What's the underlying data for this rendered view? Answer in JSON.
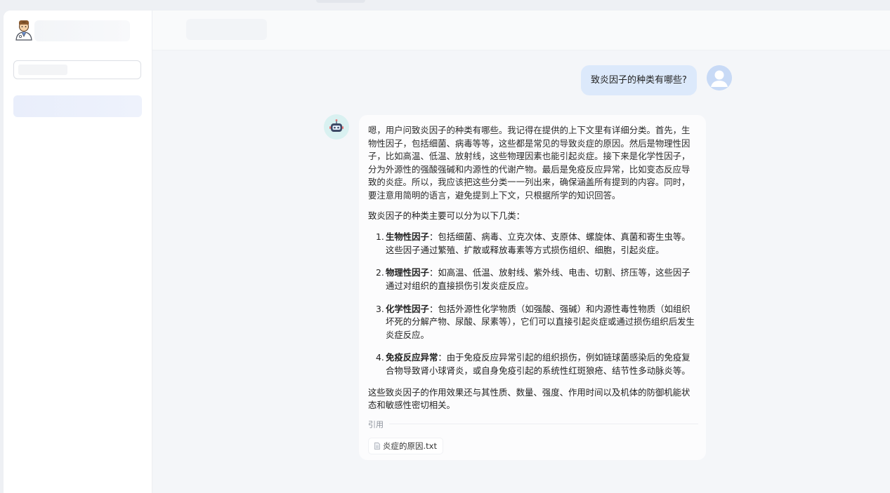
{
  "user_message": "致炎因子的种类有哪些?",
  "assistant": {
    "thinking": "嗯，用户问致炎因子的种类有哪些。我记得在提供的上下文里有详细分类。首先，生物性因子，包括细菌、病毒等等，这些都是常见的导致炎症的原因。然后是物理性因子，比如高温、低温、放射线，这些物理因素也能引起炎症。接下来是化学性因子，分为外源性的强酸强碱和内源性的代谢产物。最后是免疫反应异常，比如变态反应导致的炎症。所以，我应该把这些分类一一列出来，确保涵盖所有提到的内容。同时，要注意用简明的语言，避免提到上下文，只根据所学的知识回答。",
    "lead": "致炎因子的种类主要可以分为以下几类：",
    "items": [
      {
        "num": "1.",
        "title": "生物性因子",
        "text": "：包括细菌、病毒、立克次体、支原体、螺旋体、真菌和寄生虫等。这些因子通过繁殖、扩散或释放毒素等方式损伤组织、细胞，引起炎症。"
      },
      {
        "num": "2.",
        "title": "物理性因子",
        "text": "：如高温、低温、放射线、紫外线、电击、切割、挤压等，这些因子通过对组织的直接损伤引发炎症反应。"
      },
      {
        "num": "3.",
        "title": "化学性因子",
        "text": "：包括外源性化学物质（如强酸、强碱）和内源性毒性物质（如组织坏死的分解产物、尿酸、尿素等），它们可以直接引起炎症或通过损伤组织后发生炎症反应。"
      },
      {
        "num": "4.",
        "title": "免疫反应异常",
        "text": "：由于免疫反应异常引起的组织损伤，例如链球菌感染后的免疫复合物导致肾小球肾炎，或自身免疫引起的系统性红斑狼疮、结节性多动脉炎等。"
      }
    ],
    "closing": "这些致炎因子的作用效果还与其性质、数量、强度、作用时间以及机体的防御机能状态和敏感性密切相关。",
    "refs_label": "引用",
    "ref_file": "炎症的原因.txt"
  }
}
